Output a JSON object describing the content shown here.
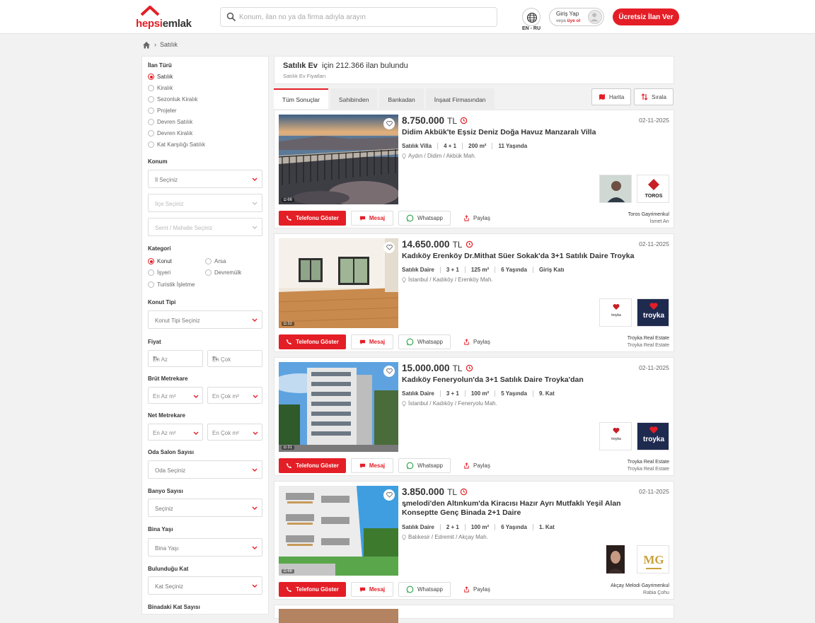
{
  "header": {
    "logo_text_red": "hepsi",
    "logo_text_dark": "emlak",
    "search_placeholder": "Konum, ilan no ya da firma adıyla arayın",
    "language_label": "EN - RU",
    "login_title": "Giriş Yap",
    "login_subtitle_prefix": "veya",
    "login_subtitle_link": "üye ol",
    "cta_label": "Ücretsiz İlan Ver"
  },
  "breadcrumb": {
    "current": "Satılık"
  },
  "sidebar": {
    "listing_type_title": "İlan Türü",
    "listing_types": [
      "Satılık",
      "Kiralık",
      "Sezonluk Kiralık",
      "Projeler",
      "Devren Satılık",
      "Devren Kiralık",
      "Kat Karşılığı Satılık"
    ],
    "listing_type_selected": "Satılık",
    "location_title": "Konum",
    "location_fields": [
      "İl Seçiniz",
      "İlçe Seçiniz",
      "Semt / Mahalle Seçiniz"
    ],
    "category_title": "Kategori",
    "categories": [
      "Konut",
      "Arsa",
      "İşyeri",
      "Devremülk",
      "Turistik İşletme"
    ],
    "category_selected": "Konut",
    "housing_type_title": "Konut Tipi",
    "housing_type_placeholder": "Konut Tipi Seçiniz",
    "price_title": "Fiyat",
    "price_min": "En Az",
    "price_max": "En Çok",
    "currency": "TL",
    "gross_area_title": "Brüt Metrekare",
    "net_area_title": "Net Metrekare",
    "area_min": "En Az m²",
    "area_max": "En Çok m²",
    "rooms_title": "Oda Salon Sayısı",
    "rooms_placeholder": "Oda Seçiniz",
    "bath_title": "Banyo Sayısı",
    "bath_placeholder": "Seçiniz",
    "age_title": "Bina Yaşı",
    "age_placeholder": "Bina Yaşı",
    "floor_title": "Bulunduğu Kat",
    "floor_placeholder": "Kat Seçiniz",
    "floors_title": "Binadaki Kat Sayısı"
  },
  "results": {
    "type": "Satılık Ev",
    "count_text": "için 212.366 ilan bulundu",
    "subtitle": "Satılık Ev Fiyatları"
  },
  "tabs": [
    "Tüm Sonuçlar",
    "Sahibinden",
    "Bankadan",
    "İnşaat Firmasından"
  ],
  "view": {
    "map_label": "Harita",
    "sort_label": "Sırala"
  },
  "actions": {
    "phone": "Telefonu Göster",
    "message": "Mesaj",
    "whatsapp": "Whatsapp",
    "share": "Paylaş"
  },
  "listings": [
    {
      "price": "8.750.000",
      "currency": "TL",
      "date": "02-11-2025",
      "title": "Didim Akbük'te Eşsiz Deniz Doğa Havuz Manzaralı Villa",
      "specs": [
        "Satılık Villa",
        "4 + 1",
        "200 m²",
        "11 Yaşında"
      ],
      "location": "Aydın / Didim / Akbük Mah.",
      "photo_count": "66",
      "agency": "Toros Gayrimenkul",
      "agent": "İsmet Arı",
      "logo_text": "TOROS"
    },
    {
      "price": "14.650.000",
      "currency": "TL",
      "date": "02-11-2025",
      "title": "Kadıköy Erenköy Dr.Mithat Süer Sokak'da 3+1 Satılık Daire Troyka",
      "specs": [
        "Satılık Daire",
        "3 + 1",
        "125 m²",
        "6 Yaşında",
        "Giriş Katı"
      ],
      "location": "İstanbul / Kadıköy / Erenköy Mah.",
      "photo_count": "32",
      "agency": "Troyka Real Estate",
      "agent": "Troyka Real Estate",
      "logo_text": "troyka"
    },
    {
      "price": "15.000.000",
      "currency": "TL",
      "date": "02-11-2025",
      "title": "Kadıköy Feneryolun'da 3+1 Satılık Daire Troyka'dan",
      "specs": [
        "Satılık Daire",
        "3 + 1",
        "100 m²",
        "5 Yaşında",
        "9. Kat"
      ],
      "location": "İstanbul / Kadıköy / Feneryolu Mah.",
      "photo_count": "31",
      "agency": "Troyka Real Estate",
      "agent": "Troyka Real Estate",
      "logo_text": "troyka"
    },
    {
      "price": "3.850.000",
      "currency": "TL",
      "date": "02-11-2025",
      "title": "ᶊmelodi'den Altınkum'da Kiracısı Hazır Ayrı Mutfaklı Yeşil Alan Konseptte Genç Binada 2+1 Daire",
      "specs": [
        "Satılık Daire",
        "2 + 1",
        "100 m²",
        "6 Yaşında",
        "1. Kat"
      ],
      "location": "Balıkesir / Edremit / Akçay Mah.",
      "photo_count": "66",
      "agency": "Akçay Melodi Gayrimenkul",
      "agent": "Rabia Çohu",
      "logo_text": "MG"
    }
  ],
  "colors": {
    "brand": "#e41e26",
    "troyka": "#1f2a4f"
  }
}
